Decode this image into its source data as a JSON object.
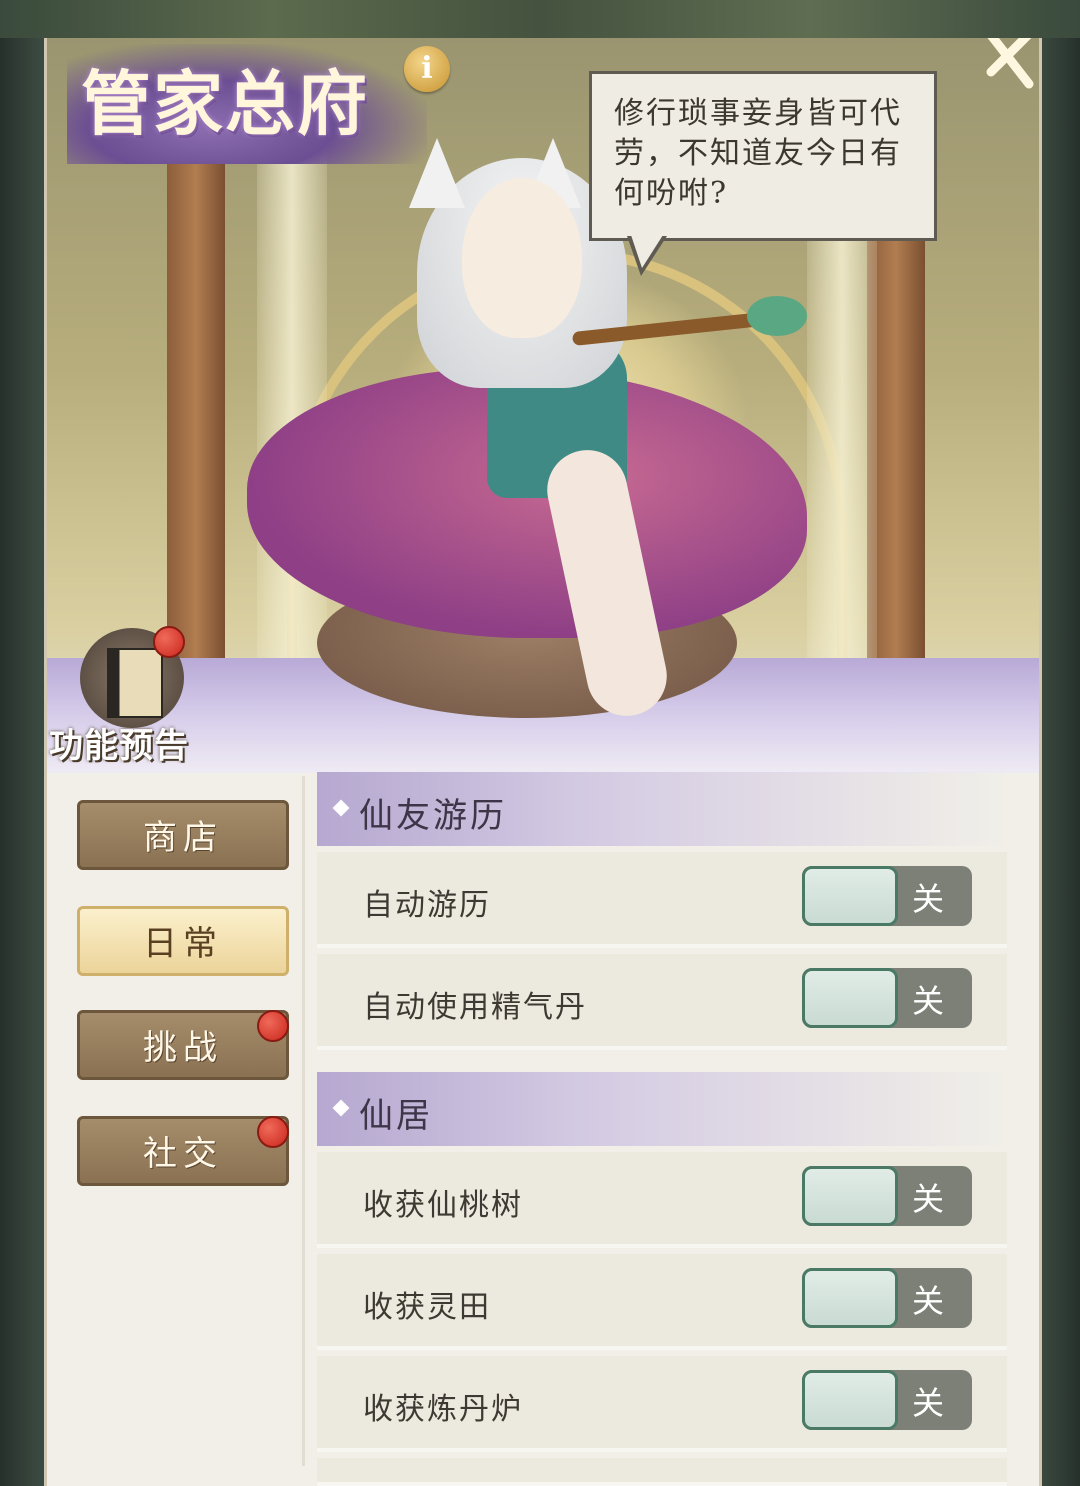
{
  "header": {
    "title": "管家总府",
    "info_label": "i"
  },
  "speech": {
    "text": "修行琐事妾身皆可代劳，不知道友今日有何吩咐?"
  },
  "preview": {
    "label": "功能预告"
  },
  "menu": {
    "items": [
      {
        "label": "商店",
        "active": false,
        "badge": false
      },
      {
        "label": "日常",
        "active": true,
        "badge": false
      },
      {
        "label": "挑战",
        "active": false,
        "badge": true
      },
      {
        "label": "社交",
        "active": false,
        "badge": true
      }
    ]
  },
  "sections": [
    {
      "title": "仙友游历",
      "rows": [
        {
          "label": "自动游历",
          "state": "关"
        },
        {
          "label": "自动使用精气丹",
          "state": "关"
        }
      ]
    },
    {
      "title": "仙居",
      "rows": [
        {
          "label": "收获仙桃树",
          "state": "关"
        },
        {
          "label": "收获灵田",
          "state": "关"
        },
        {
          "label": "收获炼丹炉",
          "state": "关"
        }
      ]
    }
  ],
  "colors": {
    "accent_purple": "#b6a8d0",
    "toggle_knob": "#d6e6df",
    "badge_red": "#d4372b",
    "menu_active": "#f3e2b0"
  }
}
